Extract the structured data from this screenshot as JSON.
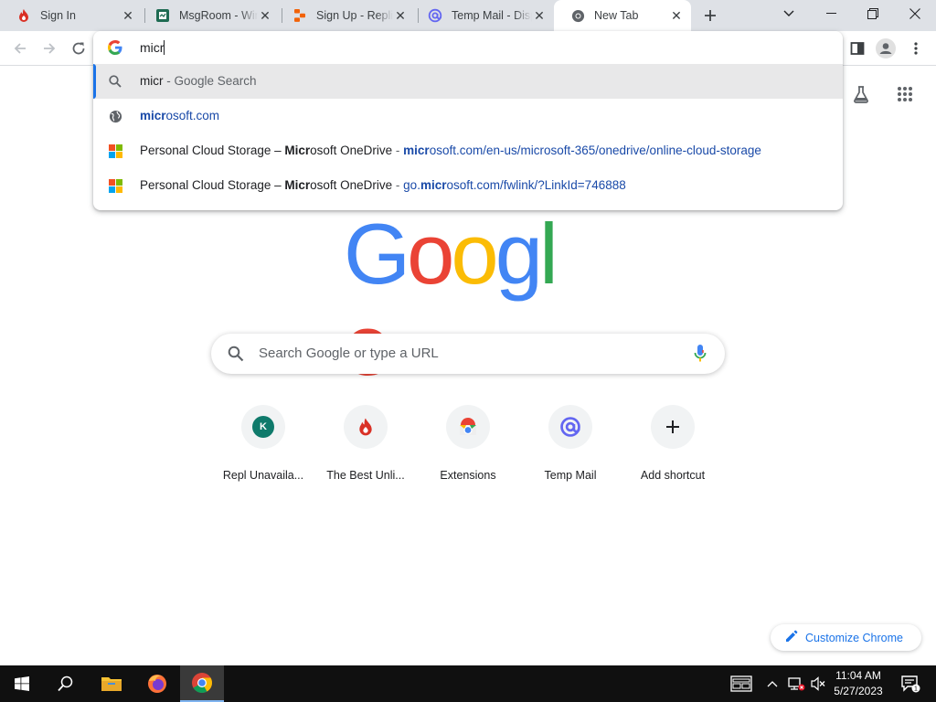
{
  "tabs": [
    {
      "title": "Sign In",
      "icon": "flame-icon"
    },
    {
      "title": "MsgRoom - Win",
      "icon": "msgroom-icon"
    },
    {
      "title": "Sign Up - Replit",
      "icon": "replit-icon"
    },
    {
      "title": "Temp Mail - Disposable",
      "icon": "at-sign-icon"
    },
    {
      "title": "New Tab",
      "icon": "chrome-icon",
      "active": true
    }
  ],
  "omnibox": {
    "typed": "micr",
    "suggestions": [
      {
        "kind": "search",
        "match": "micr",
        "rest": " - Google Search"
      },
      {
        "kind": "url",
        "match": "micr",
        "rest": "osoft.com"
      },
      {
        "kind": "page",
        "t1": "Personal Cloud Storage – ",
        "tm": "Micr",
        "t2": "osoft OneDrive",
        "sep": " - ",
        "um": "micr",
        "u2": "osoft.com/en-us/microsoft-365/onedrive/online-cloud-storage"
      },
      {
        "kind": "page",
        "t1": "Personal Cloud Storage – ",
        "tm": "Micr",
        "t2": "osoft OneDrive",
        "sep": " - ",
        "u1": "go.",
        "um": "micr",
        "u2": "osoft.com/fwlink/?LinkId=746888"
      }
    ]
  },
  "page": {
    "logo_letters": [
      "G",
      "o",
      "o",
      "g",
      "l",
      "e"
    ],
    "logo_colors": [
      "#4285f4",
      "#ea4335",
      "#fbbc05",
      "#4285f4",
      "#34a853",
      "#ea4335"
    ],
    "search_placeholder": "Search Google or type a URL",
    "shortcuts": [
      {
        "label": "Repl Unavaila...",
        "icon": "letter-k-icon",
        "letter": "K"
      },
      {
        "label": "The Best Unli...",
        "icon": "flame-icon"
      },
      {
        "label": "Extensions",
        "icon": "chrome-web-store-icon"
      },
      {
        "label": "Temp Mail",
        "icon": "at-sign-icon"
      },
      {
        "label": "Add shortcut",
        "icon": "plus-icon"
      }
    ],
    "customize_label": "Customize Chrome"
  },
  "taskbar": {
    "time": "11:04 AM",
    "date": "5/27/2023",
    "notification_count": "1"
  }
}
